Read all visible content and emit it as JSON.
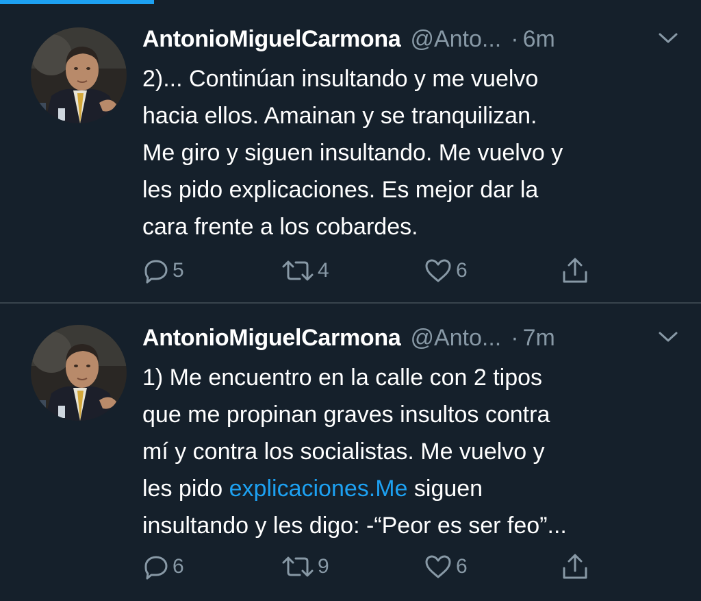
{
  "colors": {
    "background": "#15202b",
    "divider": "#38444d",
    "accent": "#1da1f2",
    "secondary_text": "#8899a6",
    "primary_text": "#ffffff"
  },
  "top_progress": 0.22,
  "tweets": [
    {
      "author_name": "AntonioMiguelCarmona",
      "handle": "@Anto...",
      "separator": "·",
      "time": "6m",
      "text_lines": [
        "2)... Continúan insultando y me vuelvo",
        "hacia ellos. Amainan y se tranquilizan.",
        "Me giro y siguen insultando. Me vuelvo y",
        "les pido explicaciones. Es mejor dar la",
        "cara frente a los cobardes."
      ],
      "replies": "5",
      "retweets": "4",
      "likes": "6"
    },
    {
      "author_name": "AntonioMiguelCarmona",
      "handle": "@Anto...",
      "separator": "·",
      "time": "7m",
      "text_lines": [
        "1) Me encuentro en la calle con 2 tipos",
        "que me propinan graves insultos contra",
        "mí y contra los socialistas. Me vuelvo y"
      ],
      "text_line4_prefix": "les pido ",
      "text_link": "explicaciones.Me",
      "text_line4_suffix": " siguen",
      "text_line5": "insultando y les digo: -“Peor es ser feo”...",
      "replies": "6",
      "retweets": "9",
      "likes": "6"
    }
  ],
  "icons": {
    "reply": "reply-icon",
    "retweet": "retweet-icon",
    "like": "heart-icon",
    "share": "share-icon",
    "caret": "chevron-down-icon"
  }
}
